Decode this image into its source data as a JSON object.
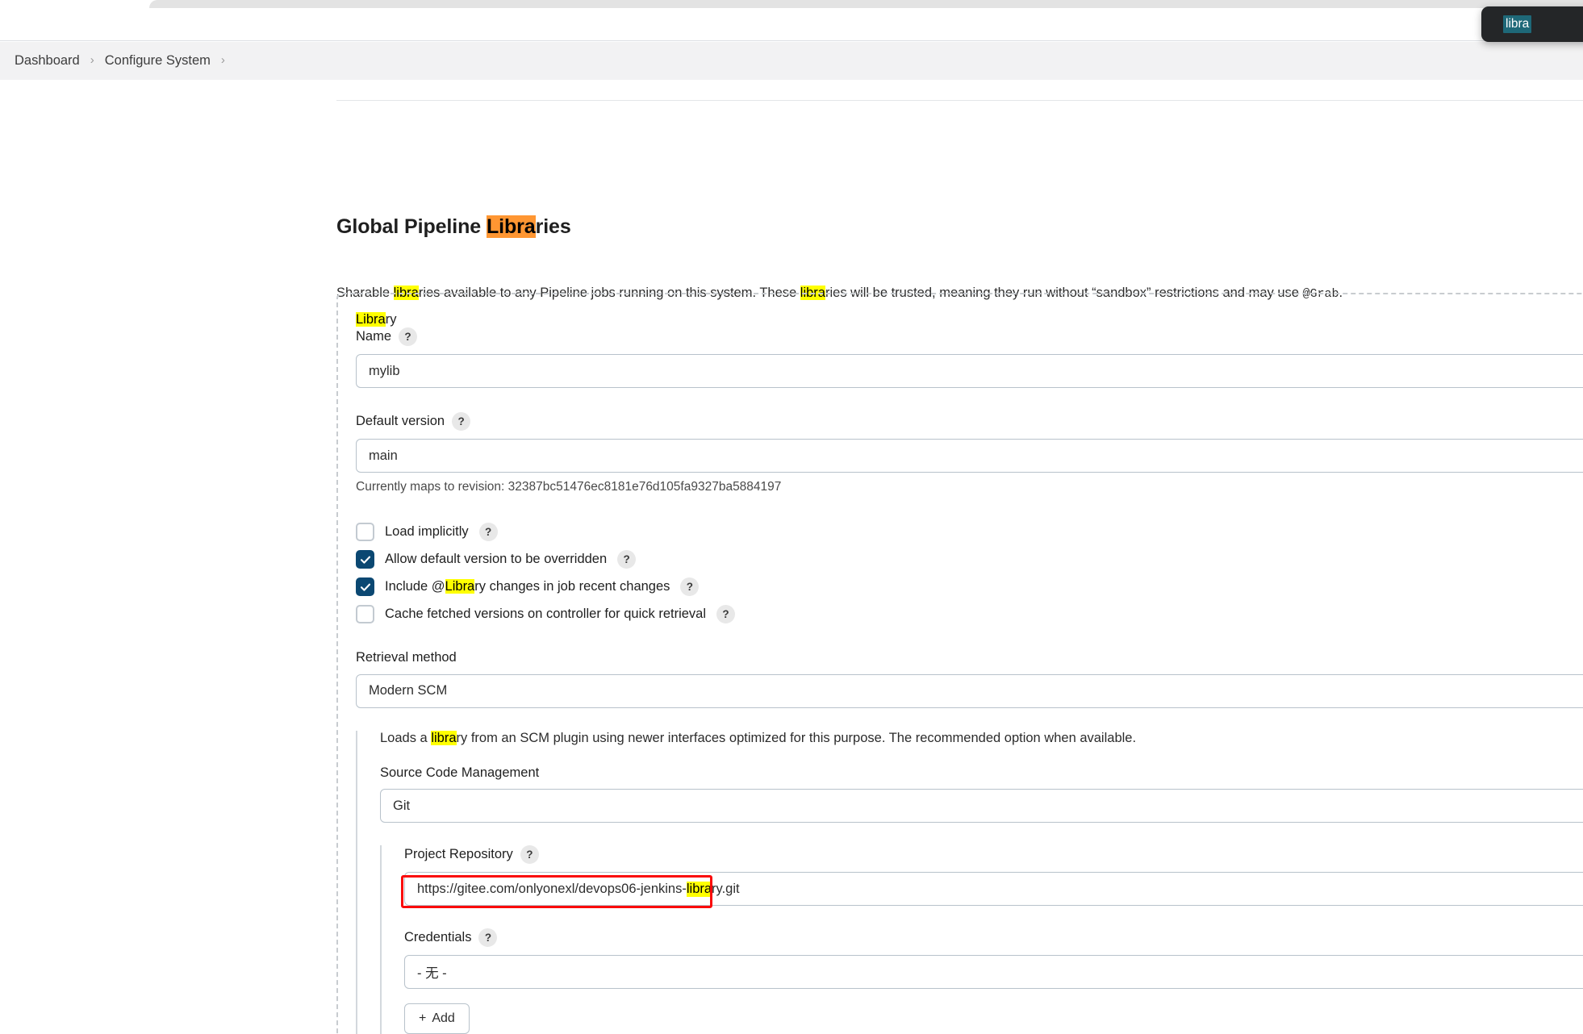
{
  "browser": {
    "find_bar": {
      "query": "libra",
      "selection_color": "#1e6878"
    }
  },
  "breadcrumb": {
    "items": [
      {
        "label": "Dashboard"
      },
      {
        "label": "Configure System"
      }
    ],
    "separator": "›"
  },
  "page": {
    "title_prefix": "Global Pipeline ",
    "title_match": "Libra",
    "title_suffix": "ries",
    "description": {
      "part1": "Sharable ",
      "match1": "libra",
      "part2": "ries available to any Pipeline jobs running on this system. These ",
      "match2": "libra",
      "part3": "ries will be trusted, meaning they run without “sandbox” restrictions and may use ",
      "code": "@Grab",
      "part4": "."
    }
  },
  "library": {
    "name_field": {
      "label_line1_match": "Libra",
      "label_line1_rest": "ry",
      "label_line2": "Name",
      "help": "?",
      "value": "mylib",
      "placeholder": "mylib"
    },
    "default_version_field": {
      "label": "Default version",
      "help": "?",
      "value": "main",
      "placeholder": "main",
      "note": "Currently maps to revision: 32387bc51476ec8181e76d105fa9327ba5884197"
    },
    "checkboxes": [
      {
        "label": "Load implicitly",
        "checked": false,
        "help": "?"
      },
      {
        "label": "Allow default version to be overridden",
        "checked": true,
        "help": "?"
      },
      {
        "label_pre": "Include @",
        "label_match": "Libra",
        "label_post": "ry changes in job recent changes",
        "checked": true,
        "help": "?"
      },
      {
        "label": "Cache fetched versions on controller for quick retrieval",
        "checked": false,
        "help": "?"
      }
    ],
    "retrieval_method": {
      "label": "Retrieval method",
      "value": "Modern SCM",
      "description": {
        "part1": "Loads a ",
        "match": "libra",
        "part2": "ry from an SCM plugin using newer interfaces optimized for this purpose. The recommended option when available."
      }
    },
    "scm": {
      "label": "Source Code Management",
      "value": "Git",
      "project_repository": {
        "label": "Project Repository",
        "help": "?",
        "value_pre": "https://gitee.com/onlyonexl/devops06-jenkins-",
        "value_match": "libra",
        "value_post": "ry.git",
        "annotation_color": "#fa0a0a"
      },
      "credentials": {
        "label": "Credentials",
        "help": "?",
        "value": "- 无 -"
      },
      "add_button": {
        "icon": "+",
        "label": "Add"
      }
    }
  }
}
